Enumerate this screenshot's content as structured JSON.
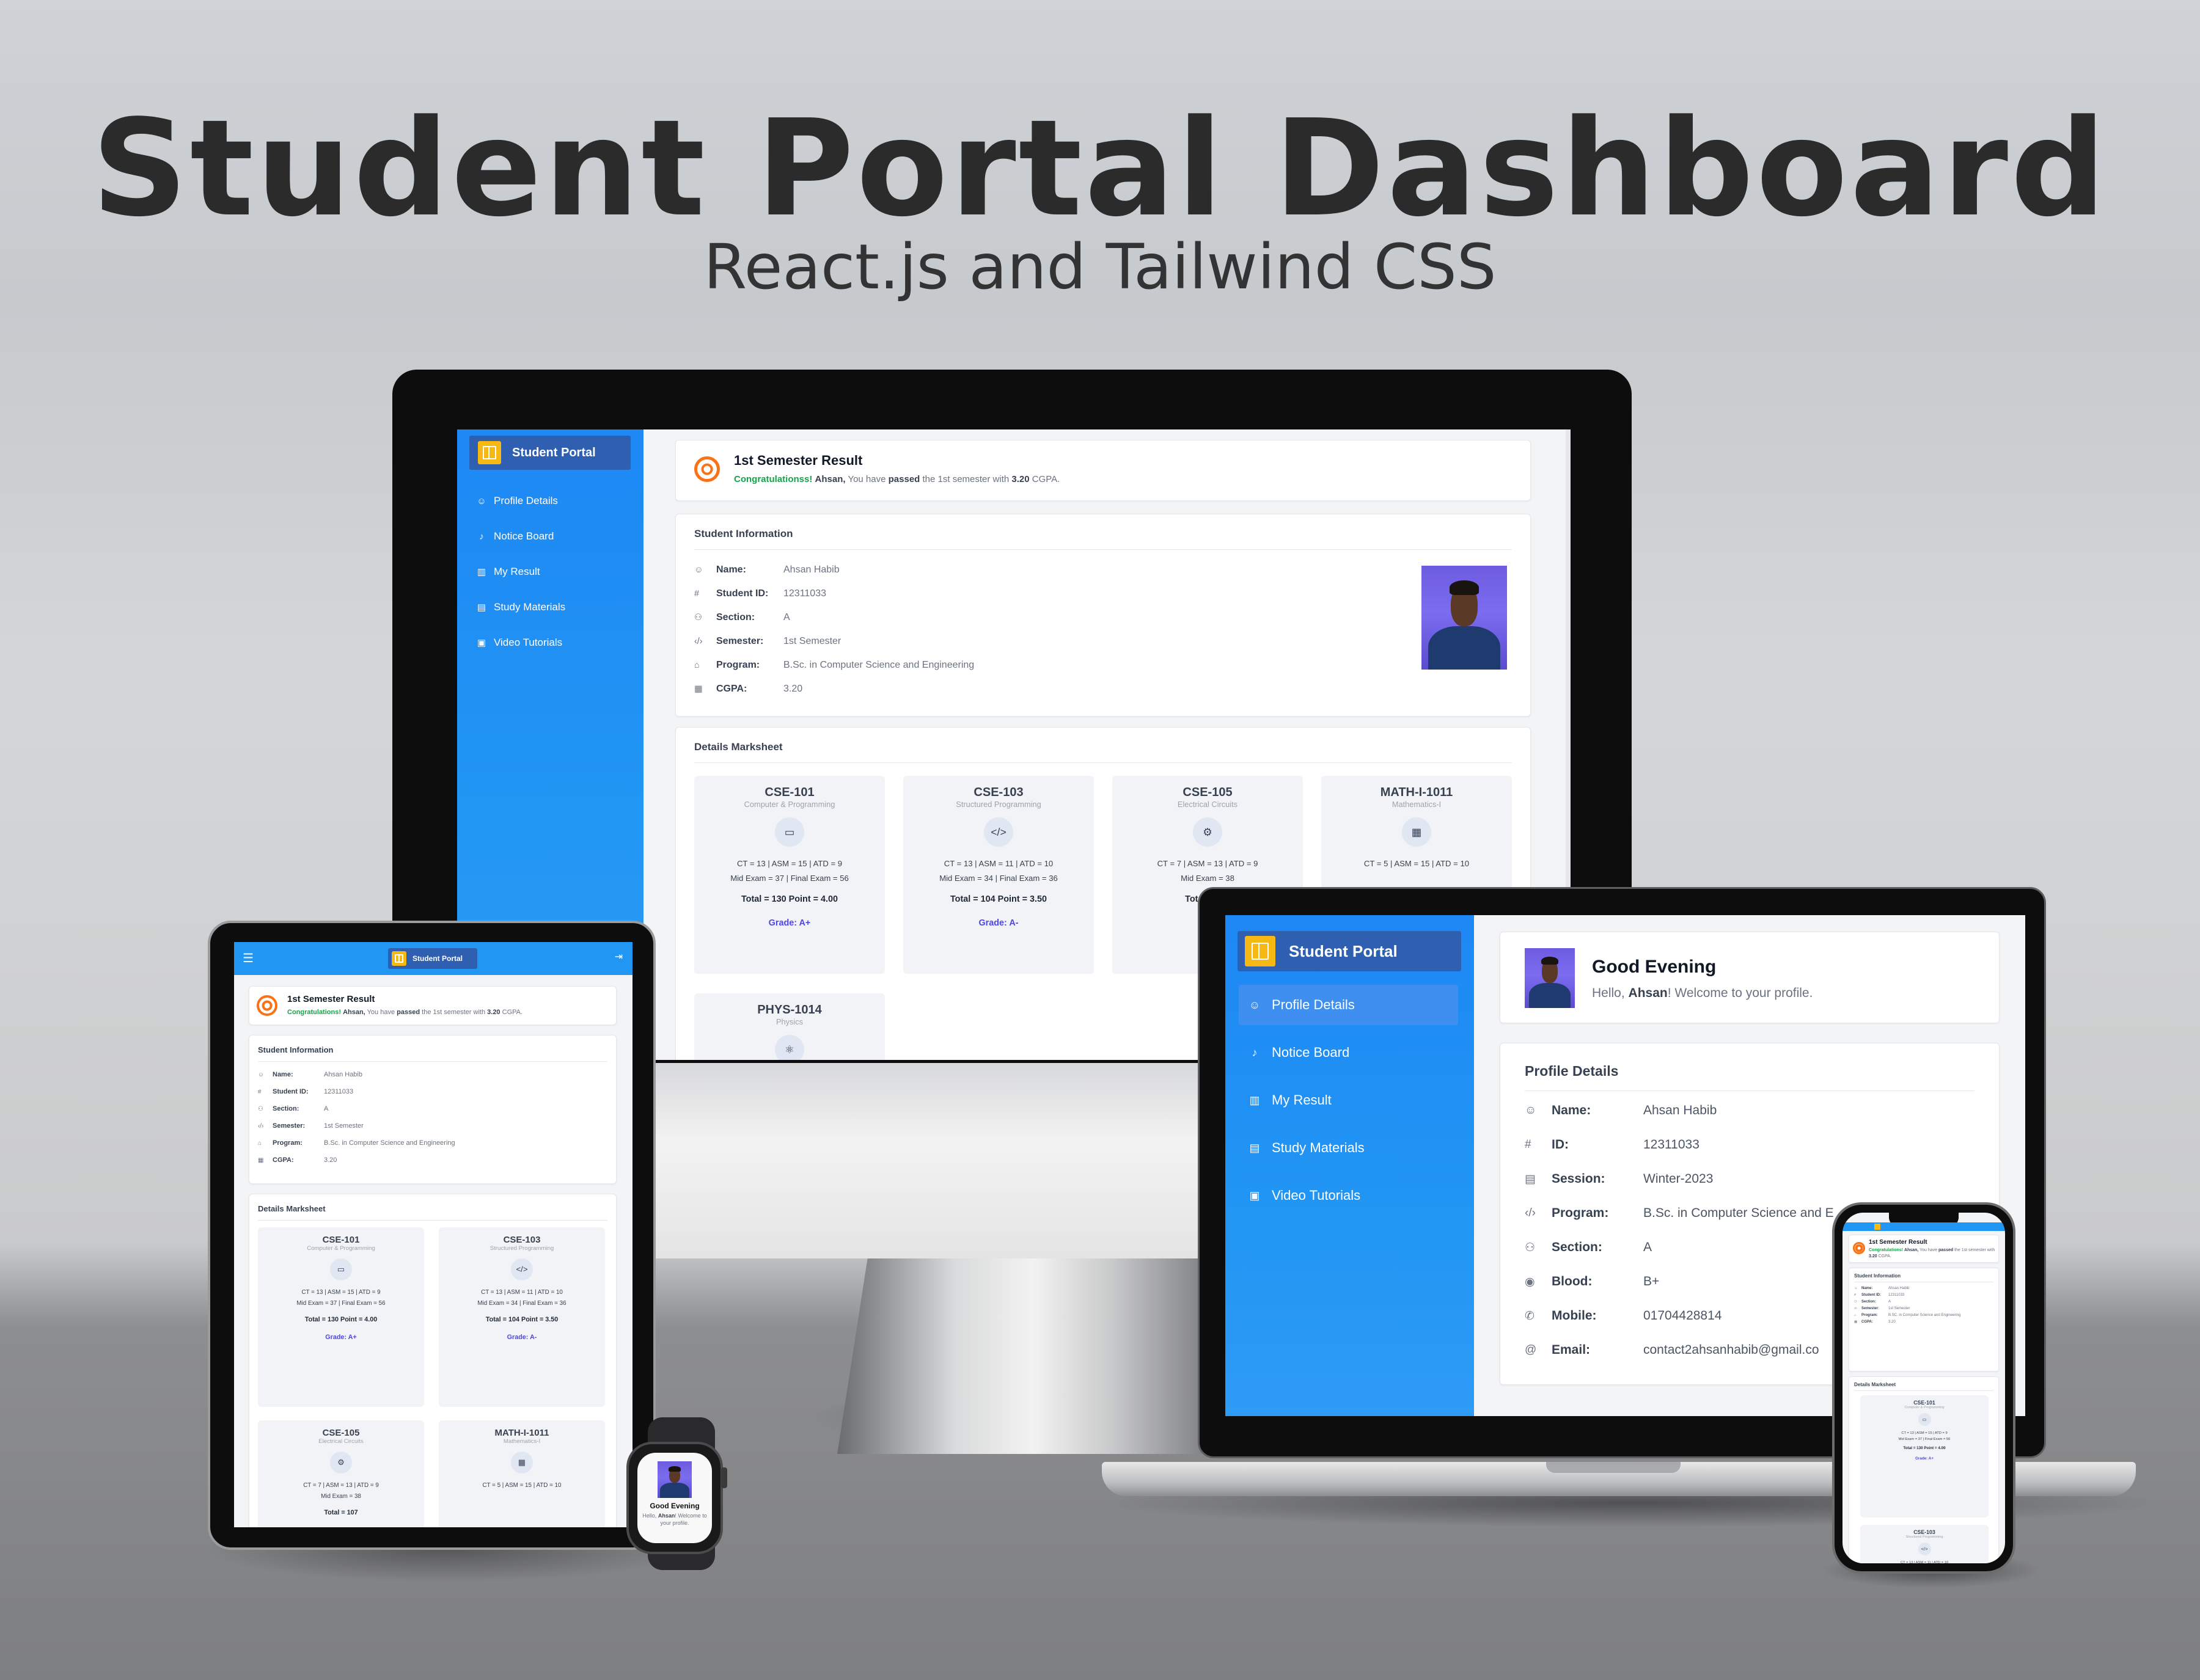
{
  "headline": {
    "title": "Student Portal Dashboard",
    "subtitle": "React.js and Tailwind CSS"
  },
  "colors": {
    "sidebar": "#1e88f5",
    "brand_bar": "#2f5fb1",
    "logo": "#f6b914",
    "accent_orange": "#f97316",
    "success": "#16a34a",
    "grade": "#4f46e5"
  },
  "brand": "Student Portal",
  "nav": [
    {
      "label": "Profile Details",
      "icon": "user-icon"
    },
    {
      "label": "Notice Board",
      "icon": "bell-icon"
    },
    {
      "label": "My Result",
      "icon": "bar-chart-icon"
    },
    {
      "label": "Study Materials",
      "icon": "document-icon"
    },
    {
      "label": "Video Tutorials",
      "icon": "video-icon"
    }
  ],
  "result": {
    "title": "1st Semester Result",
    "congrats": "Congratulationss!",
    "congrats_short": "Congratulations!",
    "name": "Ahsan,",
    "t1": "You have",
    "passed": "passed",
    "t2": "the 1st semester with",
    "cgpa": "3.20",
    "t3": "CGPA."
  },
  "student_info": {
    "title": "Student Information",
    "rows": [
      {
        "key": "Name:",
        "value": "Ahsan Habib"
      },
      {
        "key": "Student ID:",
        "value": "12311033"
      },
      {
        "key": "Section:",
        "value": "A"
      },
      {
        "key": "Semester:",
        "value": "1st Semester"
      },
      {
        "key": "Program:",
        "value": "B.Sc. in Computer Science and Engineering"
      },
      {
        "key": "CGPA:",
        "value": "3.20"
      }
    ],
    "program_short": "B.SC. in Computer Science and Engineering"
  },
  "marksheet": {
    "title": "Details Marksheet",
    "subjects": [
      {
        "code": "CSE-101",
        "name": "Computer & Programming",
        "icon": "monitor-icon",
        "glyph": "▭",
        "ct": "CT = 13",
        "asm": "ASM = 15",
        "atd": "ATD = 9",
        "mid": "Mid Exam = 37",
        "final": "Final Exam = 56",
        "total": "Total = 130",
        "point": "Point = 4.00",
        "grade": "Grade:  A+"
      },
      {
        "code": "CSE-103",
        "name": "Structured Programming",
        "icon": "code-icon",
        "glyph": "</>",
        "ct": "CT = 13",
        "asm": "ASM = 11",
        "atd": "ATD = 10",
        "mid": "Mid Exam = 34",
        "final": "Final Exam = 36",
        "total": "Total = 104",
        "point": "Point = 3.50",
        "grade": "Grade:  A-"
      },
      {
        "code": "CSE-105",
        "name": "Electrical Circuits",
        "icon": "chip-icon",
        "glyph": "⚙",
        "ct": "CT = 7",
        "asm": "ASM = 13",
        "atd": "ATD = 9",
        "mid": "Mid Exam = 38",
        "final": "",
        "total": "Total = 107",
        "point": "",
        "grade": "Gr"
      },
      {
        "code": "MATH-I-1011",
        "name": "Mathematics-I",
        "icon": "calculator-icon",
        "glyph": "▦",
        "ct": "CT = 5",
        "asm": "ASM = 15",
        "atd": "ATD = 10",
        "mid": "",
        "final": "",
        "total": "",
        "point": "",
        "grade": ""
      },
      {
        "code": "PHYS-1014",
        "name": "Physics",
        "icon": "atom-icon",
        "glyph": "⚛"
      }
    ]
  },
  "greeting": {
    "title": "Good Evening",
    "hello": "Hello,",
    "name": "Ahsan",
    "rest": "! Welcome to your profile.",
    "watch_rest": "! Welcome to",
    "watch_rest2": "your profile."
  },
  "profile": {
    "title": "Profile Details",
    "rows": [
      {
        "key": "Name:",
        "value": "Ahsan Habib",
        "icon": "user-icon",
        "glyph": "☺"
      },
      {
        "key": "ID:",
        "value": "12311033",
        "icon": "hash-icon",
        "glyph": "#"
      },
      {
        "key": "Session:",
        "value": "Winter-2023",
        "icon": "calendar-icon",
        "glyph": "▤"
      },
      {
        "key": "Program:",
        "value": "B.Sc. in Computer Science and E",
        "icon": "code-icon",
        "glyph": "‹/›"
      },
      {
        "key": "Section:",
        "value": "A",
        "icon": "users-icon",
        "glyph": "⚇"
      },
      {
        "key": "Blood:",
        "value": "B+",
        "icon": "droplet-icon",
        "glyph": "◉"
      },
      {
        "key": "Mobile:",
        "value": "01704428814",
        "icon": "phone-icon",
        "glyph": "✆"
      },
      {
        "key": "Email:",
        "value": "contact2ahsanhabib@gmail.co",
        "icon": "at-icon",
        "glyph": "@"
      }
    ]
  }
}
